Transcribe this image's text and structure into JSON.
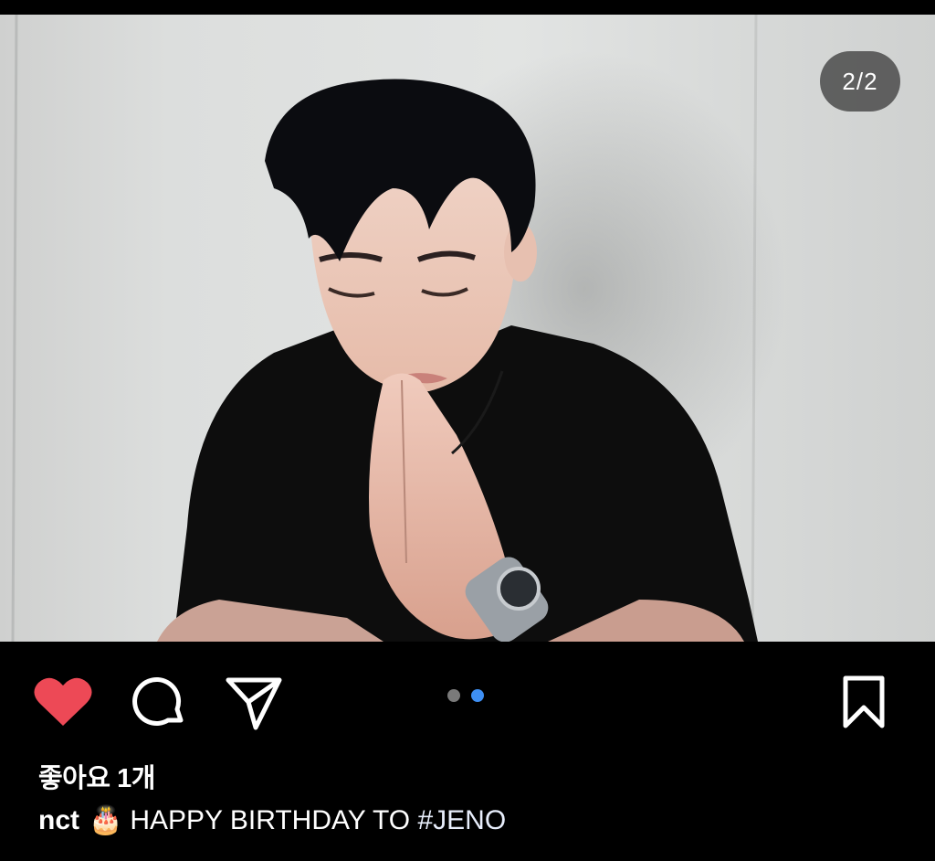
{
  "post": {
    "image_counter": "2/2",
    "image_alt": "Photo of a man in a black t-shirt with hands pressed together",
    "carousel_active_index": 2,
    "carousel_total": 2
  },
  "actions": {
    "like_icon": "heart-filled-icon",
    "comment_icon": "comment-icon",
    "share_icon": "paper-plane-icon",
    "save_icon": "bookmark-icon",
    "like_color": "#ed4956",
    "dot_active_color": "#3e8ff3"
  },
  "likes": {
    "label": "좋아요 1개"
  },
  "caption": {
    "username": "nct",
    "emoji": "🎂",
    "text": "HAPPY BIRTHDAY TO ",
    "hashtag": "#JENO"
  }
}
